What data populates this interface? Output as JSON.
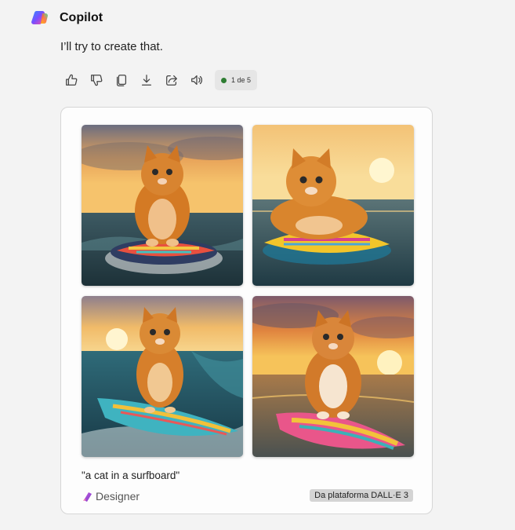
{
  "header": {
    "app_name": "Copilot",
    "logo_icon": "copilot-logo"
  },
  "message": {
    "text": "I’ll try to create that."
  },
  "actions": {
    "icons": [
      "thumbs-up-icon",
      "thumbs-down-icon",
      "copy-icon",
      "download-icon",
      "share-icon",
      "speaker-icon"
    ],
    "pager_text": "1 de 5",
    "pager_status_color": "#2e7d32"
  },
  "result": {
    "images": [
      {
        "subject": "orange cat on surfboard at sunset"
      },
      {
        "subject": "orange cat lying on surfboard"
      },
      {
        "subject": "orange cat standing on surfboard"
      },
      {
        "subject": "orange cat sitting on surfboard"
      }
    ],
    "prompt": "\"a cat in a surfboard\"",
    "designer_label": "Designer",
    "badge": "Da plataforma DALL·E 3"
  }
}
